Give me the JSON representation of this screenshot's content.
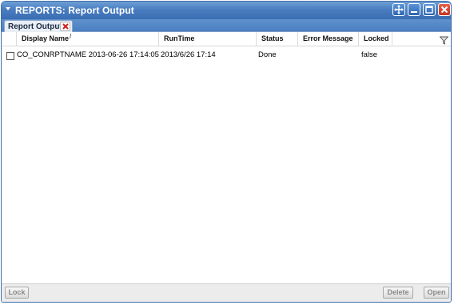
{
  "window": {
    "title": "REPORTS: Report Output",
    "buttons": {
      "move_icon": "move-icon",
      "minimize_icon": "minimize-icon",
      "maximize_icon": "maximize-icon",
      "close_icon": "close-icon"
    }
  },
  "tabs": [
    {
      "label": "Report Output",
      "active": true,
      "close_icon": "close-x-icon"
    }
  ],
  "grid": {
    "columns": [
      "Display Name",
      "RunTime",
      "Status",
      "Error Message",
      "Locked"
    ],
    "sorted_column": "Display Name",
    "filter_icon": "filter-funnel-icon",
    "rows": [
      {
        "checked": false,
        "display_name": "CO_CONRPTNAME 2013-06-26 17:14:05",
        "runtime": "2013/6/26 17:14",
        "status": "Done",
        "error_message": "",
        "locked": "false"
      }
    ]
  },
  "footer": {
    "lock_label": "Lock",
    "delete_label": "Delete",
    "open_label": "Open"
  },
  "colors": {
    "titlebar": "#4a7dc0",
    "close_button": "#c23522",
    "disabled_text": "#8a8a8a"
  }
}
